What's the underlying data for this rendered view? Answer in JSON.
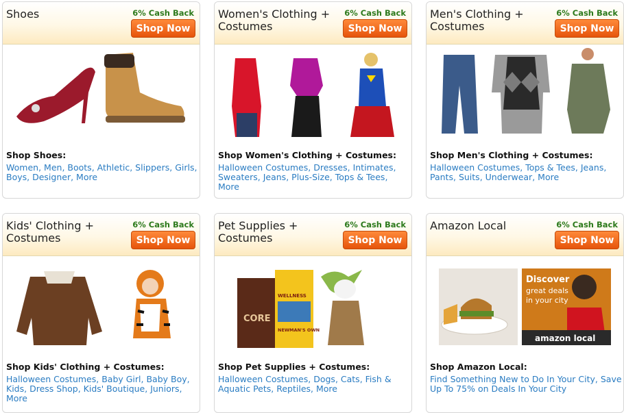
{
  "cards": [
    {
      "title": "Shoes",
      "cashback": "6% Cash Back",
      "button": "Shop Now",
      "shop_label": "Shop Shoes:",
      "links": [
        "Women",
        "Men",
        "Boots",
        "Athletic",
        "Slippers",
        "Girls",
        "Boys",
        "Designer",
        "More"
      ]
    },
    {
      "title": "Women's Clothing + Costumes",
      "cashback": "6% Cash Back",
      "button": "Shop Now",
      "shop_label": "Shop Women's Clothing + Costumes:",
      "links": [
        "Halloween Costumes",
        "Dresses",
        "Intimates",
        "Sweaters",
        "Jeans",
        "Plus-Size",
        "Tops & Tees",
        "More"
      ]
    },
    {
      "title": "Men's Clothing + Costumes",
      "cashback": "6% Cash Back",
      "button": "Shop Now",
      "shop_label": "Shop Men's Clothing + Costumes:",
      "links": [
        "Halloween Costumes",
        "Tops & Tees",
        "Jeans",
        "Pants",
        "Suits",
        "Underwear",
        "More"
      ]
    },
    {
      "title": "Kids' Clothing + Costumes",
      "cashback": "6% Cash Back",
      "button": "Shop Now",
      "shop_label": "Shop Kids' Clothing + Costumes:",
      "links": [
        "Halloween Costumes",
        "Baby Girl",
        "Baby Boy",
        "Kids",
        "Dress Shop",
        "Kids' Boutique",
        "Juniors",
        "More"
      ]
    },
    {
      "title": "Pet Supplies + Costumes",
      "cashback": "6% Cash Back",
      "button": "Shop Now",
      "shop_label": "Shop Pet Supplies + Costumes:",
      "links": [
        "Halloween Costumes",
        "Dogs",
        "Cats",
        "Fish & Aquatic Pets",
        "Reptiles",
        "More"
      ]
    },
    {
      "title": "Amazon Local",
      "cashback": "6% Cash Back",
      "button": "Shop Now",
      "shop_label": "Shop Amazon Local:",
      "links": [
        "Find Something New to Do In Your City",
        "Save Up To 75% on Deals In Your City"
      ]
    }
  ],
  "amazon_local_ad": {
    "headline": "Discover",
    "subtext": "great deals in your city",
    "brand": "amazon local"
  },
  "pet_food_bags": {
    "core_label": "CORE",
    "wellness_label": "WELLNESS",
    "newmans_label": "NEWMAN'S OWN"
  },
  "colors": {
    "link": "#2a7cc2",
    "cashback": "#2c7a1c",
    "button": "#e6540b"
  }
}
